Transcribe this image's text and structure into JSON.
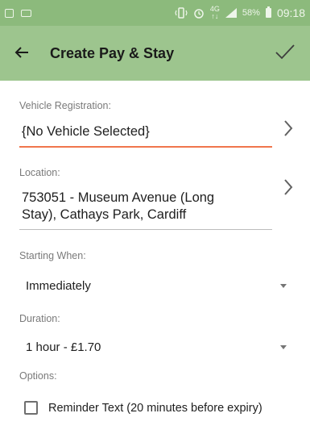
{
  "status_bar": {
    "net_top": "4G",
    "net_bottom": "↑↓",
    "battery": "58%",
    "time": "09:18"
  },
  "app_bar": {
    "title": "Create Pay & Stay"
  },
  "form": {
    "vehicle": {
      "label": "Vehicle Registration:",
      "value": "{No Vehicle Selected}"
    },
    "location": {
      "label": "Location:",
      "value_line1": "753051 - Museum Avenue (Long",
      "value_line2": "Stay), Cathays Park, Cardiff"
    },
    "starting": {
      "label": "Starting When:",
      "selected": "Immediately"
    },
    "duration": {
      "label": "Duration:",
      "selected": "1 hour - £1.70"
    },
    "options": {
      "label": "Options:",
      "reminder_label": "Reminder Text (20 minutes before expiry)",
      "reminder_checked": false
    }
  },
  "colors": {
    "app_bar": "#9dc58e",
    "status_bar": "#8cba7c",
    "accent_underline": "#f0764d"
  }
}
